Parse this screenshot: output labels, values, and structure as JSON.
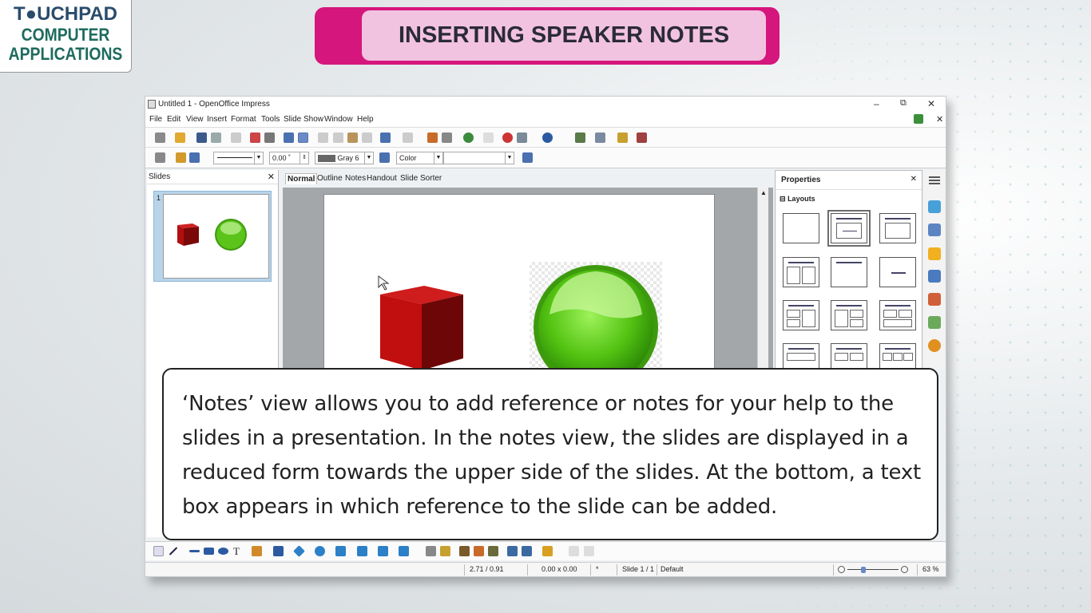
{
  "logo": {
    "line1": "T●UCHPAD",
    "line2": "COMPUTER",
    "line3": "APPLICATIONS"
  },
  "heading": "INSERTING SPEAKER NOTES",
  "window": {
    "title": "Untitled 1 - OpenOffice Impress",
    "controls": {
      "minimize": "–",
      "restore": "⧉",
      "close": "✕"
    },
    "doc_close": "✕",
    "menu": [
      "File",
      "Edit",
      "View",
      "Insert",
      "Format",
      "Tools",
      "Slide Show",
      "Window",
      "Help"
    ],
    "toolbar2": {
      "angle": "0.00 ˚",
      "fill_color": "Gray 6",
      "area_style": "Color"
    },
    "slides_pane": {
      "title": "Slides",
      "close": "✕",
      "thumb_number": "1"
    },
    "view_tabs": [
      "Normal",
      "Outline",
      "Notes",
      "Handout",
      "Slide Sorter"
    ],
    "properties": {
      "title": "Properties",
      "close": "✕",
      "section": "Layouts",
      "section_toggle": "⊟"
    },
    "status": {
      "position": "2.71 / 0.91",
      "size": "0.00 x 0.00",
      "asterisk": "*",
      "slide": "Slide 1 / 1",
      "master": "Default",
      "zoom": "63 %"
    }
  },
  "callout_text": "‘Notes’ view allows you to add reference or notes for your help to the slides in a presentation. In the notes view, the slides are displayed in a reduced form towards the upper side of the slides. At the bottom, a text box appears in which reference to the slide can be added.",
  "colors": {
    "title_border": "#d5167c",
    "title_fill": "#f2c3e1",
    "cube": "#b00d0d",
    "sphere": "#5bc41a"
  }
}
